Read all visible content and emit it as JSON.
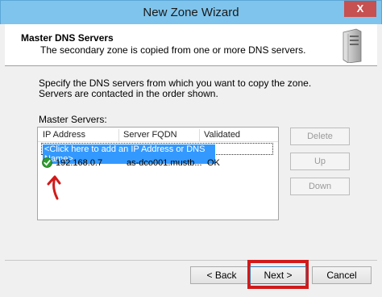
{
  "window": {
    "title": "New Zone Wizard",
    "close_label": "X"
  },
  "header": {
    "title": "Master DNS Servers",
    "subtitle": "The secondary zone is copied from one or more DNS servers.",
    "icon": "server-icon"
  },
  "content": {
    "description": "Specify the DNS servers from which you want to copy the zone.  Servers are contacted in the order shown.",
    "master_servers_label": "Master Servers:"
  },
  "list": {
    "columns": [
      "IP Address",
      "Server FQDN",
      "Validated"
    ],
    "add_row_text": "<Click here to add an IP Address or DNS Name>",
    "rows": [
      {
        "ip": "192.168.0.7",
        "fqdn": "as-dco001.mustb...",
        "validated": "OK",
        "status_icon": "check-icon"
      }
    ]
  },
  "side_buttons": {
    "delete": "Delete",
    "up": "Up",
    "down": "Down"
  },
  "footer": {
    "back": "< Back",
    "next": "Next >",
    "cancel": "Cancel"
  },
  "colors": {
    "titlebar": "#7fc4ec",
    "selection": "#3399ff",
    "close": "#c75050",
    "annotation": "#d11a1a",
    "ok_check": "#2e9d2e"
  }
}
